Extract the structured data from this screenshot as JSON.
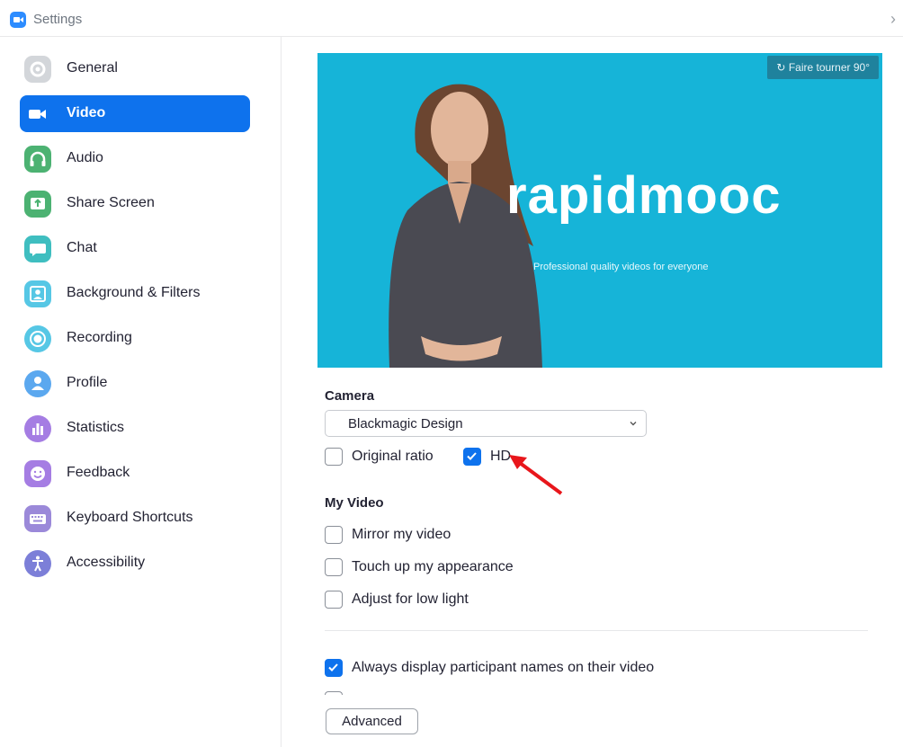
{
  "window": {
    "title": "Settings"
  },
  "sidebar": {
    "items": [
      {
        "label": "General",
        "icon": "gear-icon",
        "color": "#d3d6da",
        "active": false
      },
      {
        "label": "Video",
        "icon": "video-camera-icon",
        "color": "#0e72ed",
        "active": true
      },
      {
        "label": "Audio",
        "icon": "headphones-icon",
        "color": "#4cb272",
        "active": false
      },
      {
        "label": "Share Screen",
        "icon": "share-screen-icon",
        "color": "#4cb272",
        "active": false
      },
      {
        "label": "Chat",
        "icon": "chat-bubble-icon",
        "color": "#3fbec0",
        "active": false
      },
      {
        "label": "Background & Filters",
        "icon": "portrait-icon",
        "color": "#56c7e5",
        "active": false
      },
      {
        "label": "Recording",
        "icon": "record-icon",
        "color": "#56c7e5",
        "active": false
      },
      {
        "label": "Profile",
        "icon": "person-icon",
        "color": "#5ba8ef",
        "active": false
      },
      {
        "label": "Statistics",
        "icon": "bar-chart-icon",
        "color": "#a57de3",
        "active": false
      },
      {
        "label": "Feedback",
        "icon": "smiley-icon",
        "color": "#a57de3",
        "active": false
      },
      {
        "label": "Keyboard Shortcuts",
        "icon": "keyboard-icon",
        "color": "#9b89d9",
        "active": false
      },
      {
        "label": "Accessibility",
        "icon": "accessibility-icon",
        "color": "#7c7fd8",
        "active": false
      }
    ]
  },
  "preview": {
    "rotate_label": "Faire tourner 90°",
    "brand_text": "rapidmooc",
    "tagline": "Professional quality videos for everyone"
  },
  "camera": {
    "section_title": "Camera",
    "selected_device": "Blackmagic Design",
    "original_ratio": {
      "label": "Original ratio",
      "checked": false
    },
    "hd": {
      "label": "HD",
      "checked": true
    }
  },
  "my_video": {
    "section_title": "My Video",
    "options": [
      {
        "label": "Mirror my video",
        "checked": false
      },
      {
        "label": "Touch up my appearance",
        "checked": false
      },
      {
        "label": "Adjust for low light",
        "checked": false
      }
    ]
  },
  "display": {
    "always_display_names": {
      "label": "Always display participant names on their video",
      "checked": true
    }
  },
  "advanced_button": {
    "label": "Advanced"
  },
  "annotation": {
    "arrow_color": "#e8161b"
  }
}
